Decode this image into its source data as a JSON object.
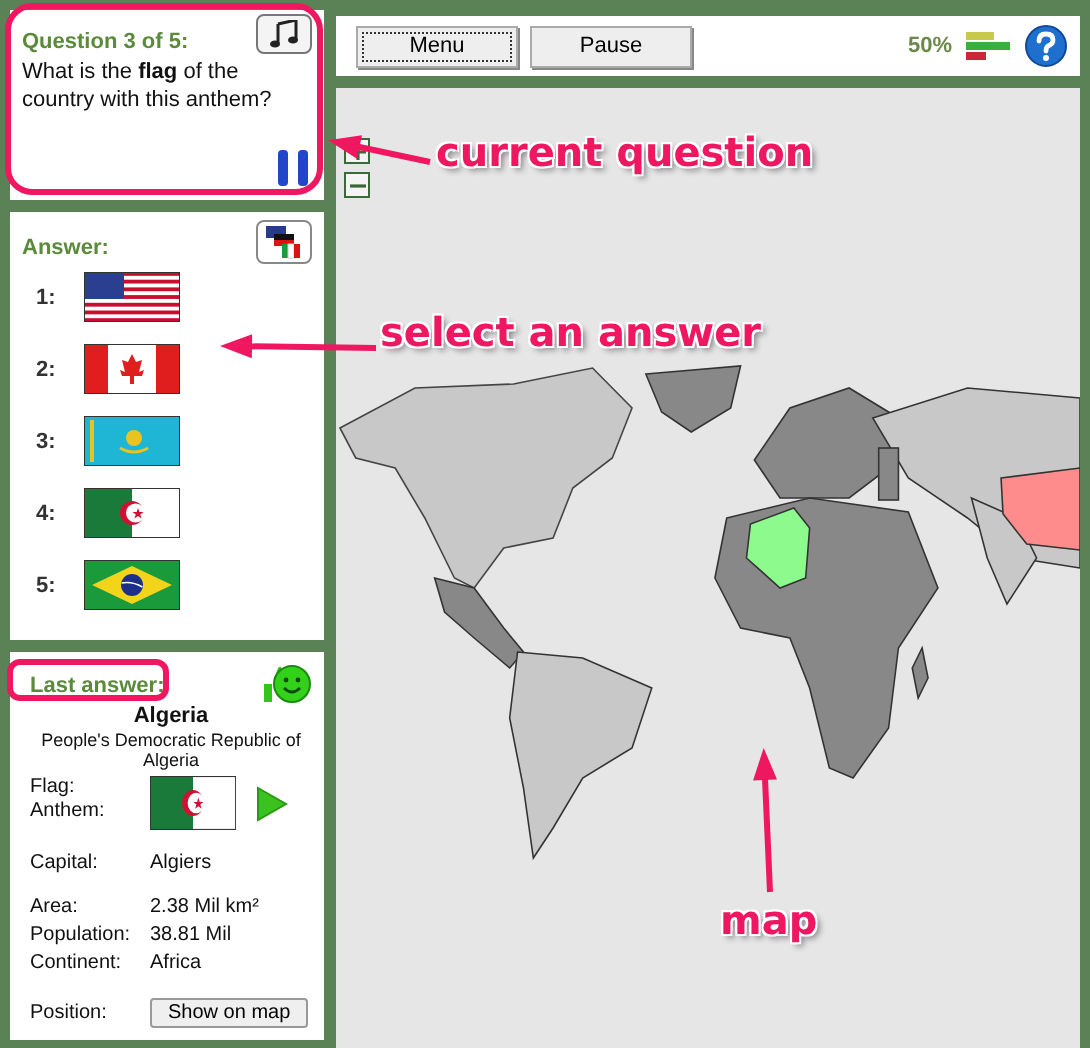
{
  "question": {
    "title": "Question 3 of 5:",
    "text": "What is the **flag** of the country with this anthem?"
  },
  "toolbar": {
    "buttons": [
      {
        "label": "Menu",
        "focused": true
      },
      {
        "label": "Pause",
        "focused": false
      }
    ],
    "score": "50%"
  },
  "answers": {
    "title": "Answer:",
    "options": [
      {
        "number": "1:",
        "kind": "usa"
      },
      {
        "number": "2:",
        "kind": "canada"
      },
      {
        "number": "3:",
        "kind": "kazakhstan"
      },
      {
        "number": "4:",
        "kind": "algeria"
      },
      {
        "number": "5:",
        "kind": "brazil"
      }
    ]
  },
  "last_answer": {
    "title": "Last answer:",
    "correct": true,
    "country": "Algeria",
    "official_name": "People's Democratic Republic of Algeria",
    "flag_label": "Flag:",
    "anthem_label": "Anthem:",
    "flag": {
      "kind": "algeria"
    },
    "fields": [
      {
        "label": "Capital:",
        "value": "Algiers"
      },
      {
        "label": "Area:",
        "value": "2.38 Mil km²"
      },
      {
        "label": "Population:",
        "value": "38.81 Mil"
      },
      {
        "label": "Continent:",
        "value": "Africa"
      }
    ],
    "position_label": "Position:",
    "position_button": "Show on map"
  },
  "annotations": [
    {
      "text": "current question"
    },
    {
      "text": "select an answer"
    },
    {
      "text": "map"
    }
  ]
}
